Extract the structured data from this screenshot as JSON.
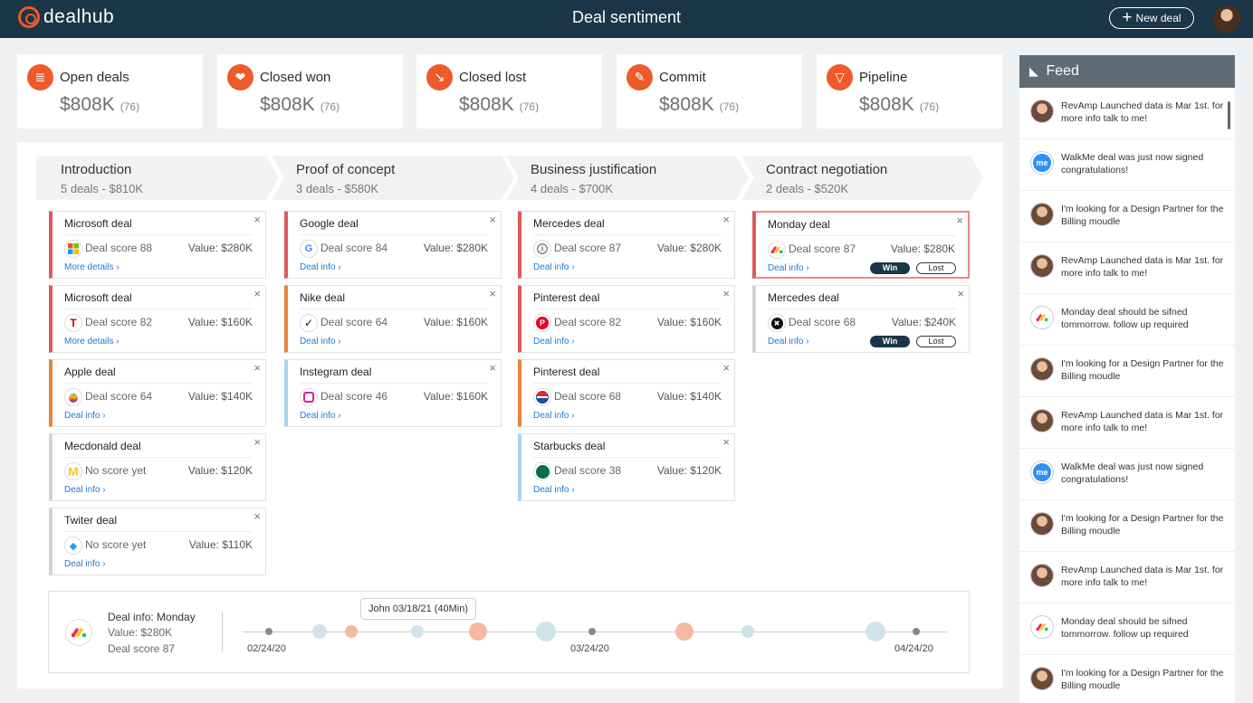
{
  "app": {
    "logo_text": "dealhub",
    "title": "Deal sentiment",
    "new_deal_label": "New deal"
  },
  "kpis": [
    {
      "title": "Open deals",
      "value": "$808K",
      "count": "(76)",
      "icon": "document-icon"
    },
    {
      "title": "Closed won",
      "value": "$808K",
      "count": "(76)",
      "icon": "handshake-icon"
    },
    {
      "title": "Closed lost",
      "value": "$808K",
      "count": "(76)",
      "icon": "trend-down-icon"
    },
    {
      "title": "Commit",
      "value": "$808K",
      "count": "(76)",
      "icon": "pencil-icon"
    },
    {
      "title": "Pipeline",
      "value": "$808K",
      "count": "(76)",
      "icon": "funnel-icon"
    }
  ],
  "stages": [
    {
      "name": "Introduction",
      "summary": "5 deals - $810K"
    },
    {
      "name": "Proof of concept",
      "summary": "3 deals - $580K"
    },
    {
      "name": "Business justification",
      "summary": "4 deals - $700K"
    },
    {
      "name": "Contract negotiation",
      "summary": "2 deals - $520K"
    }
  ],
  "columns": [
    [
      {
        "title": "Microsoft deal",
        "score": "Deal score 88",
        "value": "Value: $280K",
        "link": "More details ›",
        "logo": "microsoft-logo"
      },
      {
        "title": "Microsoft deal",
        "score": "Deal score 82",
        "value": "Value: $160K",
        "link": "More details ›",
        "logo": "tesla-logo"
      },
      {
        "title": "Apple deal",
        "score": "Deal score 64",
        "value": "Value: $140K",
        "link": "Deal info ›",
        "logo": "apple-logo"
      },
      {
        "title": "Mecdonald deal",
        "score": "No score yet",
        "value": "Value: $120K",
        "link": "Deal info ›",
        "logo": "mcdonalds-logo"
      },
      {
        "title": "Twiter deal",
        "score": "No score yet",
        "value": "Value: $110K",
        "link": "Deal info ›",
        "logo": "twitter-logo"
      }
    ],
    [
      {
        "title": "Google deal",
        "score": "Deal score 84",
        "value": "Value: $280K",
        "link": "Deal info ›",
        "logo": "google-logo"
      },
      {
        "title": "Nike deal",
        "score": "Deal score 64",
        "value": "Value: $160K",
        "link": "Deal info ›",
        "logo": "nike-logo"
      },
      {
        "title": "Instegram deal",
        "score": "Deal score 46",
        "value": "Value: $160K",
        "link": "Deal info ›",
        "logo": "instagram-logo"
      }
    ],
    [
      {
        "title": "Mercedes deal",
        "score": "Deal score 87",
        "value": "Value: $280K",
        "link": "Deal info ›",
        "logo": "mercedes-logo"
      },
      {
        "title": "Pinterest deal",
        "score": "Deal score 82",
        "value": "Value: $160K",
        "link": "Deal info ›",
        "logo": "pinterest-logo"
      },
      {
        "title": "Pinterest deal",
        "score": "Deal score 68",
        "value": "Value: $140K",
        "link": "Deal info ›",
        "logo": "pepsi-logo"
      },
      {
        "title": "Starbucks deal",
        "score": "Deal score 38",
        "value": "Value: $120K",
        "link": "Deal info ›",
        "logo": "starbucks-logo"
      }
    ],
    [
      {
        "title": "Monday deal",
        "score": "Deal score 87",
        "value": "Value: $280K",
        "link": "Deal info ›",
        "logo": "monday-logo",
        "win": "Win",
        "lost": "Lost"
      },
      {
        "title": "Mercedes deal",
        "score": "Deal score 68",
        "value": "Value: $240K",
        "link": "Deal info ›",
        "logo": "xbox-logo",
        "win": "Win",
        "lost": "Lost"
      }
    ]
  ],
  "close_symbol": "×",
  "timeline": {
    "info_title": "Deal info: Monday",
    "info_value": "Value: $280K",
    "info_score": "Deal score 87",
    "tooltip": "John 03/18/21 (40Min)",
    "dates": [
      "02/24/20",
      "03/24/20",
      "04/24/20"
    ]
  },
  "feed": {
    "title": "Feed",
    "items": [
      {
        "text": "RevAmp Launched data is Mar 1st. for more info talk to me!",
        "avatar": "person-avatar"
      },
      {
        "text": "WalkMe deal was just now signed congratulations!",
        "avatar": "walkme-logo"
      },
      {
        "text": "I'm looking for a Design Partner for the Billing moudle",
        "avatar": "person-avatar"
      },
      {
        "text": "RevAmp Launched data is Mar 1st. for more info talk to me!",
        "avatar": "person-avatar"
      },
      {
        "text": "Monday deal should be sifned tommorrow. follow up required",
        "avatar": "monday-logo"
      },
      {
        "text": "I'm looking for a Design Partner for the Billing moudle",
        "avatar": "person-avatar"
      },
      {
        "text": "RevAmp Launched data is Mar 1st. for more info talk to me!",
        "avatar": "person-avatar"
      },
      {
        "text": "WalkMe deal was just now signed congratulations!",
        "avatar": "walkme-logo"
      },
      {
        "text": "I'm looking for a Design Partner for the Billing moudle",
        "avatar": "person-avatar"
      },
      {
        "text": "RevAmp Launched data is Mar 1st. for more info talk to me!",
        "avatar": "person-avatar"
      },
      {
        "text": "Monday deal should be sifned tommorrow. follow up required",
        "avatar": "monday-logo"
      },
      {
        "text": "I'm looking for a Design Partner for the Billing moudle",
        "avatar": "person-avatar"
      }
    ]
  },
  "colors": {
    "topbar": "#1b3646",
    "accent": "#ee5a2a",
    "link": "#1f7bd4",
    "feed_header": "#5f6c75"
  }
}
